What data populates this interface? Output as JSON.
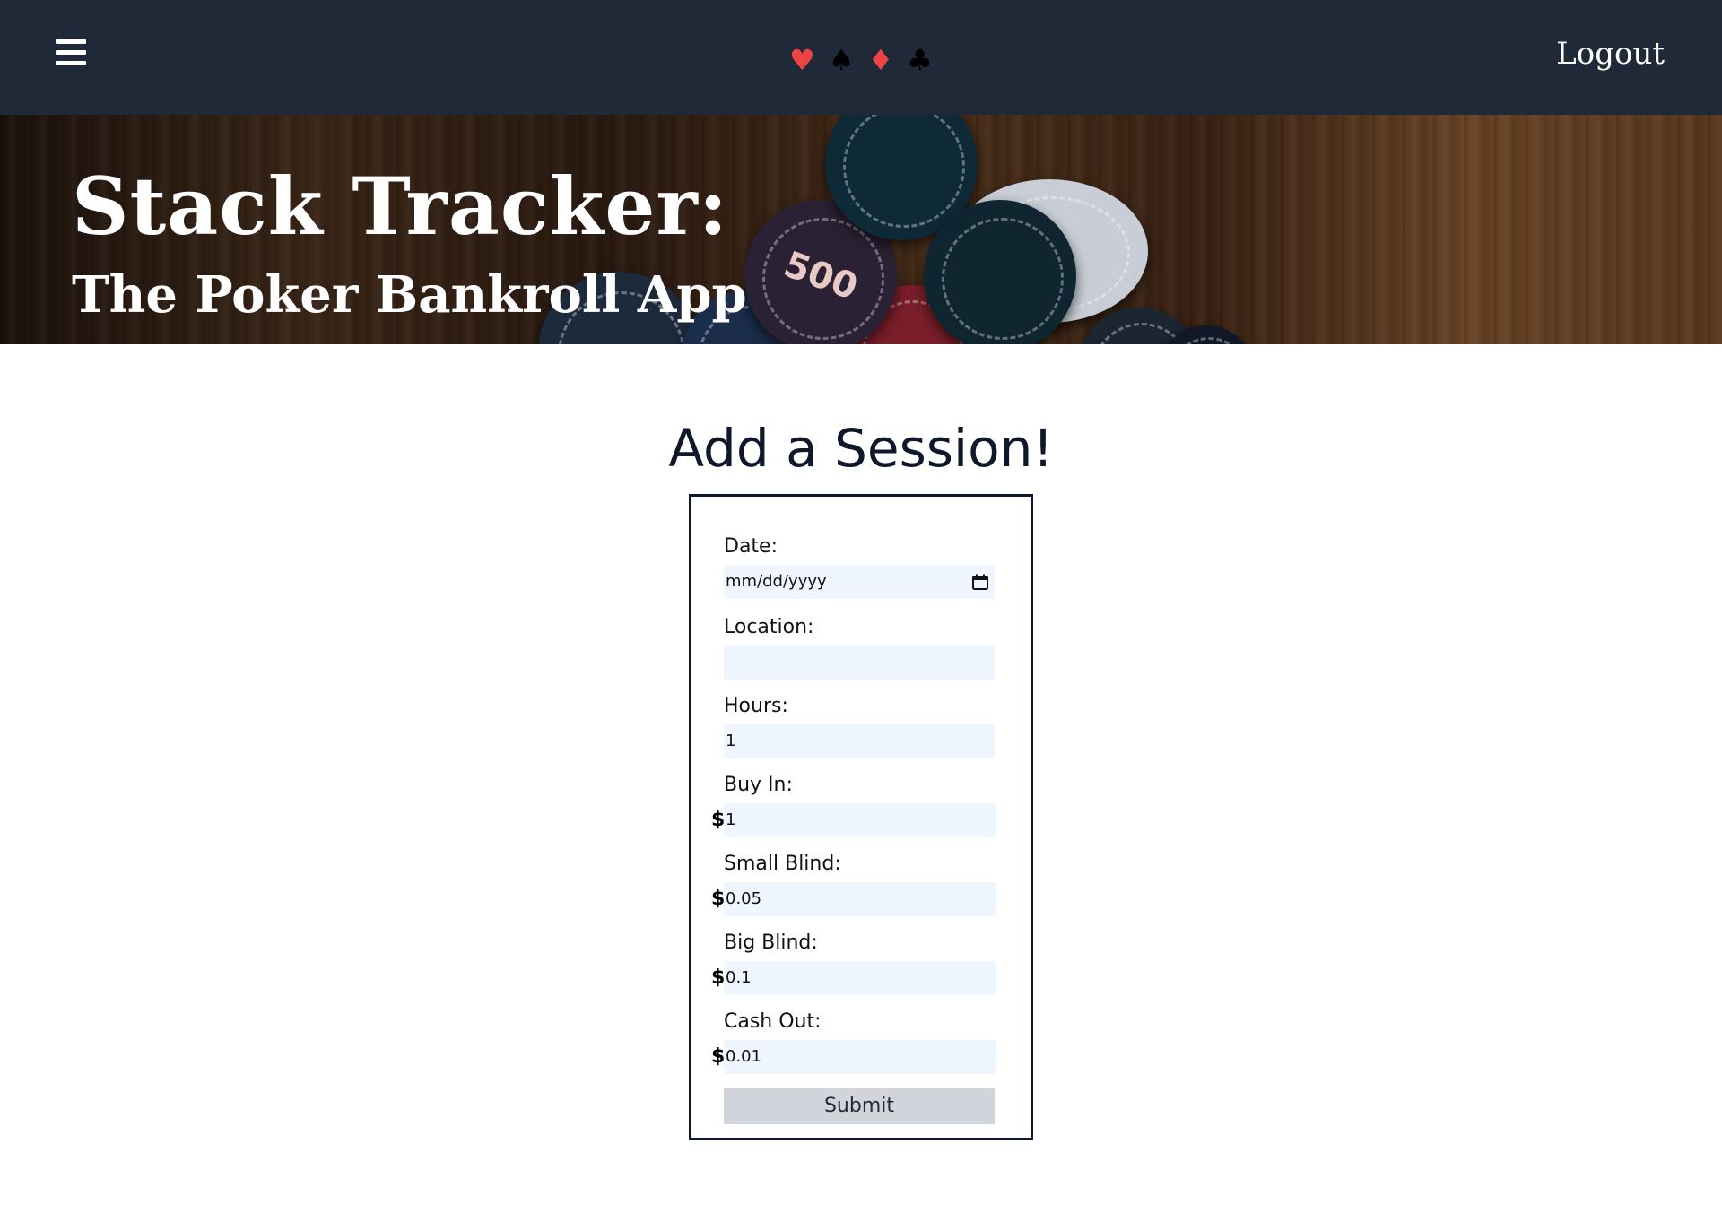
{
  "nav": {
    "menu_icon": "hamburger-menu-icon",
    "suits": [
      {
        "glyph": "♥",
        "name": "heart-suit-icon",
        "color": "#ef4444"
      },
      {
        "glyph": "♠",
        "name": "spade-suit-icon",
        "color": "#000000"
      },
      {
        "glyph": "♦",
        "name": "diamond-suit-icon",
        "color": "#ef4444"
      },
      {
        "glyph": "♣",
        "name": "club-suit-icon",
        "color": "#000000"
      }
    ],
    "logout_label": "Logout"
  },
  "hero": {
    "title": "Stack Tracker:",
    "subtitle": "The Poker Bankroll App",
    "chip_label": "500"
  },
  "form": {
    "heading": "Add a Session!",
    "date": {
      "label": "Date:",
      "placeholder": "mm/dd/yyyy",
      "value": ""
    },
    "location": {
      "label": "Location:",
      "value": ""
    },
    "hours": {
      "label": "Hours:",
      "value": "1"
    },
    "currency_symbol": "$",
    "buy_in": {
      "label": "Buy In:",
      "value": "1"
    },
    "small_blind": {
      "label": "Small Blind:",
      "value": "0.05"
    },
    "big_blind": {
      "label": "Big Blind:",
      "value": "0.1"
    },
    "cash_out": {
      "label": "Cash Out:",
      "value": "0.01"
    },
    "submit_label": "Submit"
  },
  "colors": {
    "nav_bg": "#1f2937",
    "input_bg": "#eff6ff",
    "submit_bg": "#d1d5db",
    "accent_red": "#ef4444",
    "heading_text": "#0f172a"
  }
}
